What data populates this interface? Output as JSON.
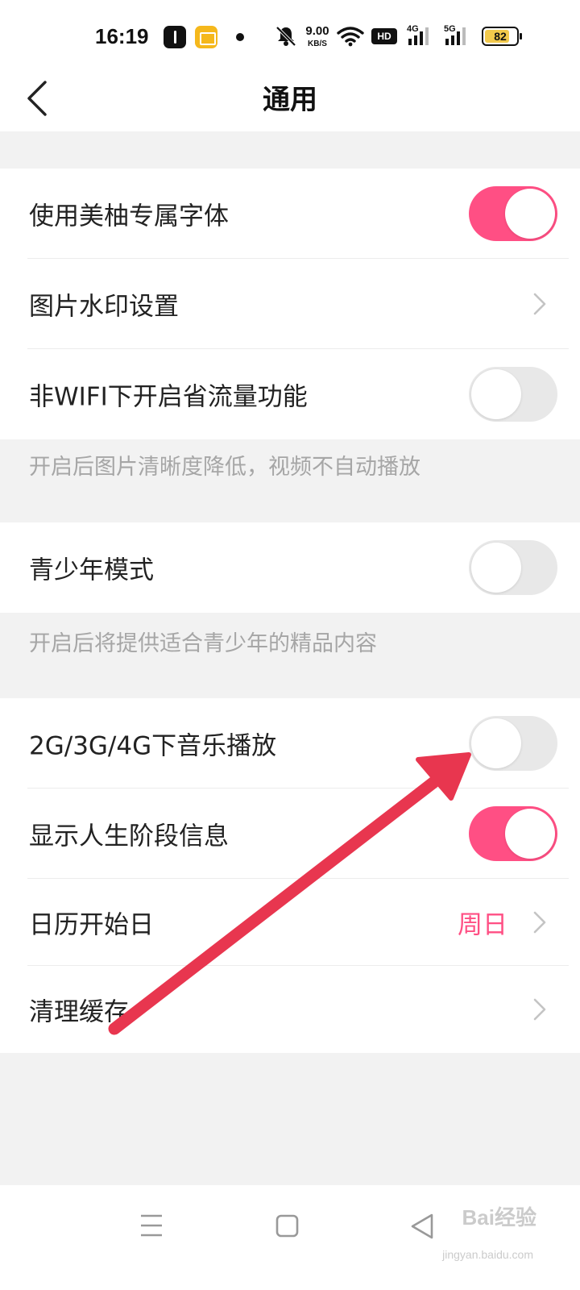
{
  "status_bar": {
    "time": "16:19",
    "net_speed": "9.00",
    "net_speed_unit": "KB/S",
    "hd_badge": "HD",
    "sim1_label": "4G",
    "sim2_label": "5G",
    "battery": "82",
    "battery_level": 0.82
  },
  "nav": {
    "title": "通用"
  },
  "settings": {
    "brand_font": {
      "label": "使用美柚专属字体",
      "enabled": true
    },
    "watermark": {
      "label": "图片水印设置"
    },
    "data_saver": {
      "label": "非WIFI下开启省流量功能",
      "enabled": false,
      "hint": "开启后图片清晰度降低，视频不自动播放"
    },
    "teen_mode": {
      "label": "青少年模式",
      "enabled": false,
      "hint": "开启后将提供适合青少年的精品内容"
    },
    "mobile_music": {
      "label": "2G/3G/4G下音乐播放",
      "enabled": false
    },
    "life_stage": {
      "label": "显示人生阶段信息",
      "enabled": true
    },
    "calendar_start": {
      "label": "日历开始日",
      "value": "周日"
    },
    "clear_cache": {
      "label": "清理缓存"
    }
  },
  "colors": {
    "accent": "#ff4f84",
    "annotation_arrow": "#e8364f",
    "toggle_off": "#e8e8e8",
    "background": "#f2f2f2"
  },
  "watermark": {
    "brand": "Bai经验",
    "url": "jingyan.baidu.com"
  }
}
